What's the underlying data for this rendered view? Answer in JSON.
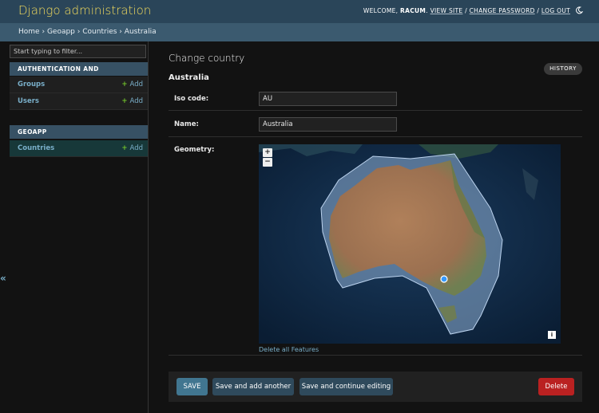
{
  "header": {
    "branding": "Django administration",
    "welcome": "Welcome,",
    "username": "racum",
    "period": ".",
    "view_site": "View site",
    "sep": "/",
    "change_password": "Change password",
    "log_out": "Log out",
    "theme_icon": "moon-icon"
  },
  "breadcrumbs": {
    "home": "Home",
    "sep": "›",
    "app": "Geoapp",
    "model": "Countries",
    "current": "Australia"
  },
  "sidebar": {
    "filter_placeholder": "Start typing to filter...",
    "apps": [
      {
        "name": "Authentication and Authorization",
        "models": [
          {
            "name": "Groups",
            "add": "Add"
          },
          {
            "name": "Users",
            "add": "Add"
          }
        ]
      },
      {
        "name": "Geoapp",
        "models": [
          {
            "name": "Countries",
            "add": "Add"
          }
        ]
      }
    ],
    "collapse_glyph": "«"
  },
  "main": {
    "page_title": "Change country",
    "object_title": "Australia",
    "history": "History",
    "fields": {
      "iso_code": {
        "label": "Iso code:",
        "value": "AU"
      },
      "name": {
        "label": "Name:",
        "value": "Australia"
      },
      "geometry": {
        "label": "Geometry:"
      }
    },
    "map": {
      "zoom_in": "+",
      "zoom_out": "−",
      "info": "i",
      "delete_features": "Delete all Features"
    }
  },
  "submit": {
    "save": "SAVE",
    "save_add": "Save and add another",
    "save_continue": "Save and continue editing",
    "delete": "Delete"
  },
  "colors": {
    "header_bg": "#2a4559",
    "branding": "#f5dd5d",
    "link": "#79aec8",
    "add": "#70bf2b",
    "delete": "#ba2121",
    "save": "#417690"
  }
}
